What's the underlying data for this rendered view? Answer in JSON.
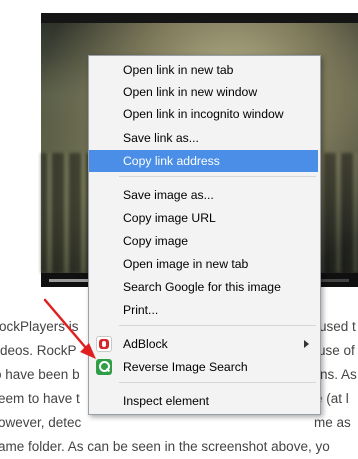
{
  "menu": {
    "items": [
      {
        "label": "Open link in new tab"
      },
      {
        "label": "Open link in new window"
      },
      {
        "label": "Open link in incognito window"
      },
      {
        "label": "Save link as..."
      },
      {
        "label": "Copy link address"
      },
      {
        "label": "Save image as..."
      },
      {
        "label": "Copy image URL"
      },
      {
        "label": "Copy image"
      },
      {
        "label": "Open image in new tab"
      },
      {
        "label": "Search Google for this image"
      },
      {
        "label": "Print..."
      },
      {
        "label": "AdBlock"
      },
      {
        "label": "Reverse Image Search"
      },
      {
        "label": "Inspect element"
      }
    ]
  },
  "article": {
    "lines": [
      {
        "left": "ockPlayers is",
        "right": "used t"
      },
      {
        "left": "ideos. RockP",
        "right": "use of"
      },
      {
        "left": "o have been b",
        "right": "ns. As"
      },
      {
        "left": "eem to have t",
        "right": "e (at l"
      },
      {
        "left": "owever, detec",
        "right": "me as"
      },
      {
        "left": "ame folder. As can be seen in the screenshot above, yo",
        "right": ""
      }
    ]
  },
  "icons": {
    "adblock": "adblock-icon",
    "reverse_image_search": "reverse-image-search-icon",
    "submenu": "chevron-right-icon",
    "annotation": "red-arrow"
  },
  "colors": {
    "highlight": "#4b8ee8",
    "menu_bg": "#f3f3f3",
    "arrow": "#e02020",
    "adblock": "#d9252a",
    "reverse_search": "#2f9e46"
  }
}
